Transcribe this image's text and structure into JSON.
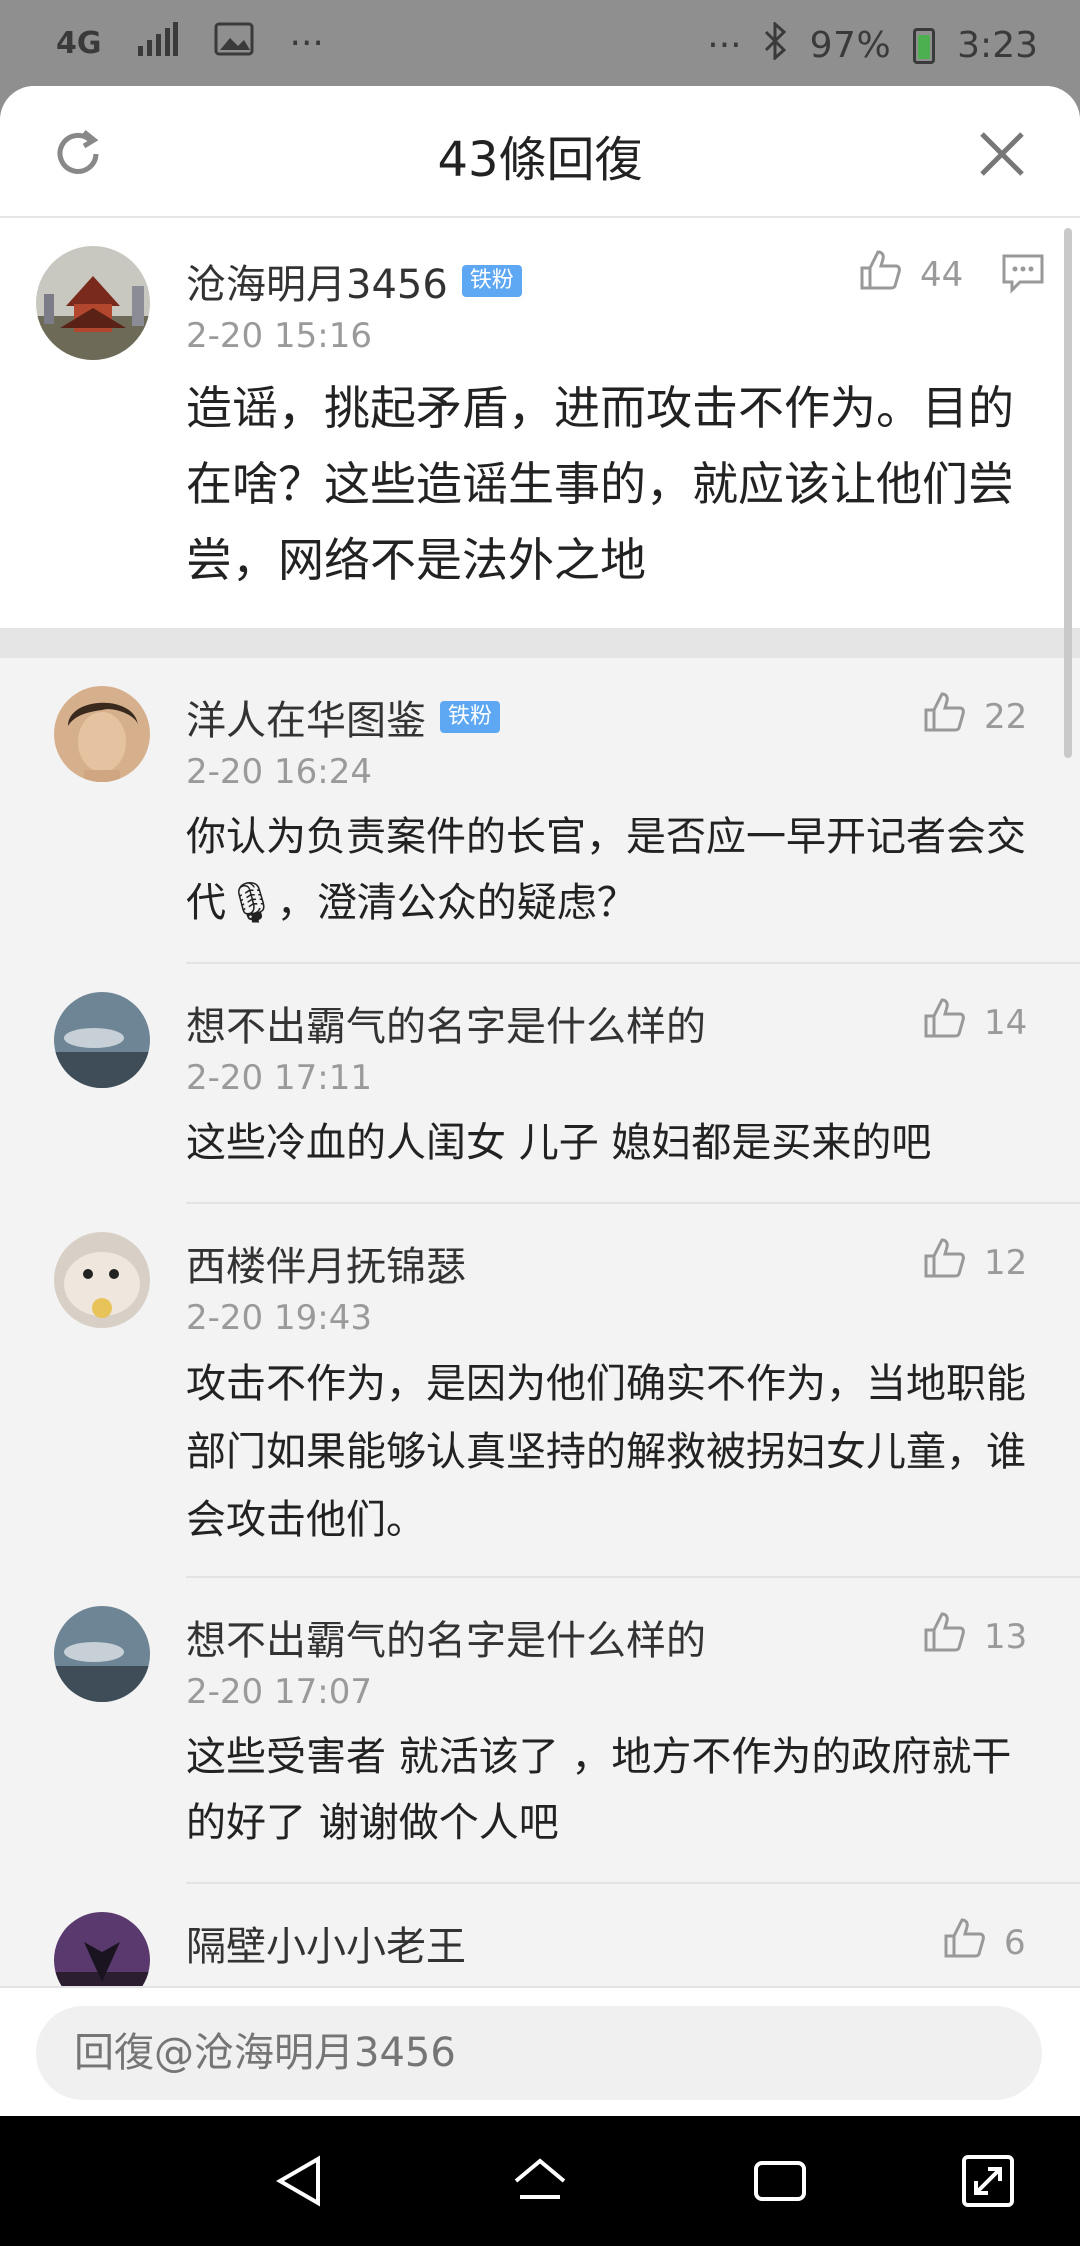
{
  "status_bar": {
    "network": "4G",
    "more_left": "···",
    "more_right": "···",
    "battery": "97%",
    "time": "3:23"
  },
  "sheet": {
    "title": "43條回復"
  },
  "main_comment": {
    "name": "沧海明月3456",
    "badge": "铁粉",
    "time": "2-20 15:16",
    "likes": "44",
    "text": "造谣，挑起矛盾，进而攻击不作为。目的在啥？这些造谣生事的，就应该让他们尝尝，网络不是法外之地"
  },
  "replies": [
    {
      "name": "洋人在华图鉴",
      "badge": "铁粉",
      "time": "2-20 16:24",
      "likes": "22",
      "text": "你认为负责案件的长官，是否应一早开记者会交代🎙，澄清公众的疑虑？"
    },
    {
      "name": "想不出霸气的名字是什么样的",
      "badge": "",
      "time": "2-20 17:11",
      "likes": "14",
      "text": "这些冷血的人闺女 儿子 媳妇都是买来的吧"
    },
    {
      "name": "西楼伴月抚锦瑟",
      "badge": "",
      "time": "2-20 19:43",
      "likes": "12",
      "text": "攻击不作为，是因为他们确实不作为，当地职能部门如果能够认真坚持的解救被拐妇女儿童，谁会攻击他们。"
    },
    {
      "name": "想不出霸气的名字是什么样的",
      "badge": "",
      "time": "2-20 17:07",
      "likes": "13",
      "text": "这些受害者 就活该了 ，地方不作为的政府就干的好了 谢谢做个人吧"
    },
    {
      "name": "隔壁小小小老王",
      "badge": "",
      "time": "",
      "likes": "6",
      "text": ""
    }
  ],
  "input": {
    "placeholder": "回復@沧海明月3456"
  }
}
